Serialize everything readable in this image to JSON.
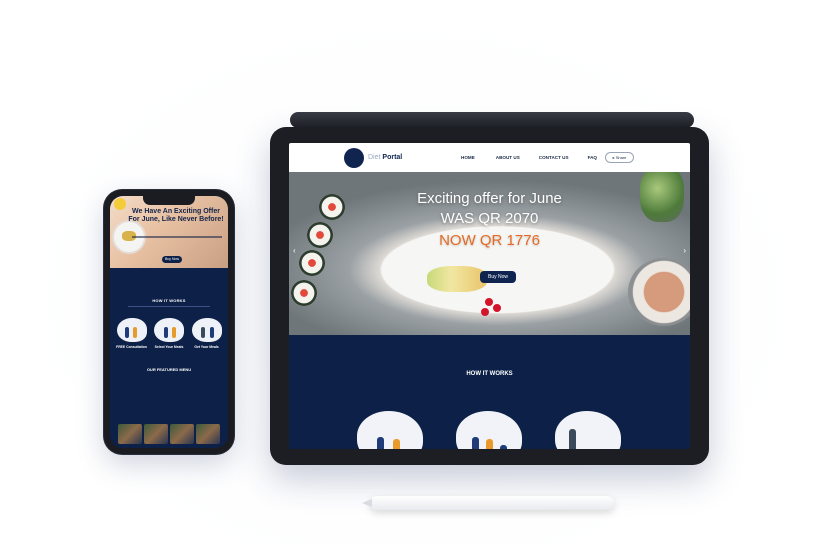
{
  "phone": {
    "hero_title": "We Have An Exciting Offer For June, Like Never Before!",
    "hero_sub": "",
    "buy_label": "Buy Now",
    "how_title": "HOW IT WORKS",
    "steps": [
      {
        "title": "FREE Consultation",
        "desc": ""
      },
      {
        "title": "Select Your Meals",
        "desc": ""
      },
      {
        "title": "Get Your Meals",
        "desc": ""
      }
    ],
    "menu_title": "OUR FEATURED MENU"
  },
  "tablet": {
    "brand_prefix": "Diet",
    "brand_main": "Portal",
    "nav": [
      "HOME",
      "ABOUT US",
      "CONTACT US",
      "FAQ"
    ],
    "share_label": "Share",
    "hero_line1": "Exciting offer for June",
    "hero_line2": "WAS QR 2070",
    "hero_line3": "NOW QR 1776",
    "hero_small": "",
    "buy_label": "Buy Now",
    "how_title": "HOW IT WORKS"
  },
  "colors": {
    "navy": "#0d2148",
    "accent_orange": "#e56a24",
    "white": "#ffffff"
  }
}
